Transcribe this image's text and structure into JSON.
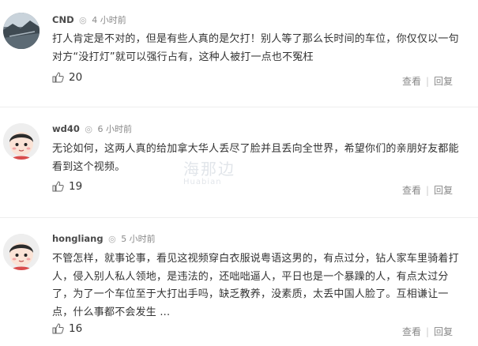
{
  "comments": [
    {
      "user": "CND",
      "time": "4 小时前",
      "text": "打人肯定是不对的，但是有些人真的是欠打！别人等了那么长时间的车位，你仅仅以一句对方“没打灯”就可以强行占有，这种人被打一点也不冤枉",
      "likes": "20",
      "view_label": "查看",
      "reply_label": "回复",
      "avatar_icon": "landscape-avatar-icon"
    },
    {
      "user": "wd40",
      "time": "6 小时前",
      "text": "无论如何，这两人真的给加拿大华人丢尽了脸并且丢向全世界，希望你们的亲朋好友都能看到这个视频。",
      "likes": "19",
      "view_label": "查看",
      "reply_label": "回复",
      "avatar_icon": "cartoon-face-avatar-icon"
    },
    {
      "user": "hongliang",
      "time": "5 小时前",
      "text": "不管怎样，就事论事，看见这视频穿白衣服说粤语这男的，有点过分，钻人家车里骑着打人，侵入别人私人领地，是违法的，还咄咄逼人，平日也是一个暴躁的人，有点太过分了，为了一个车位至于大打出手吗，缺乏教养，没素质，太丢中国人脸了。互相谦让一点，什么事都不会发生 ...",
      "likes": "16",
      "view_label": "查看",
      "reply_label": "回复",
      "avatar_icon": "cartoon-face-avatar-icon"
    }
  ],
  "watermark": {
    "text": "海那边",
    "sub": "Huabian"
  },
  "colors": {
    "text": "#333333",
    "meta": "#8a8a8a",
    "username": "#4a4a4a",
    "divider": "#eeeeee"
  }
}
